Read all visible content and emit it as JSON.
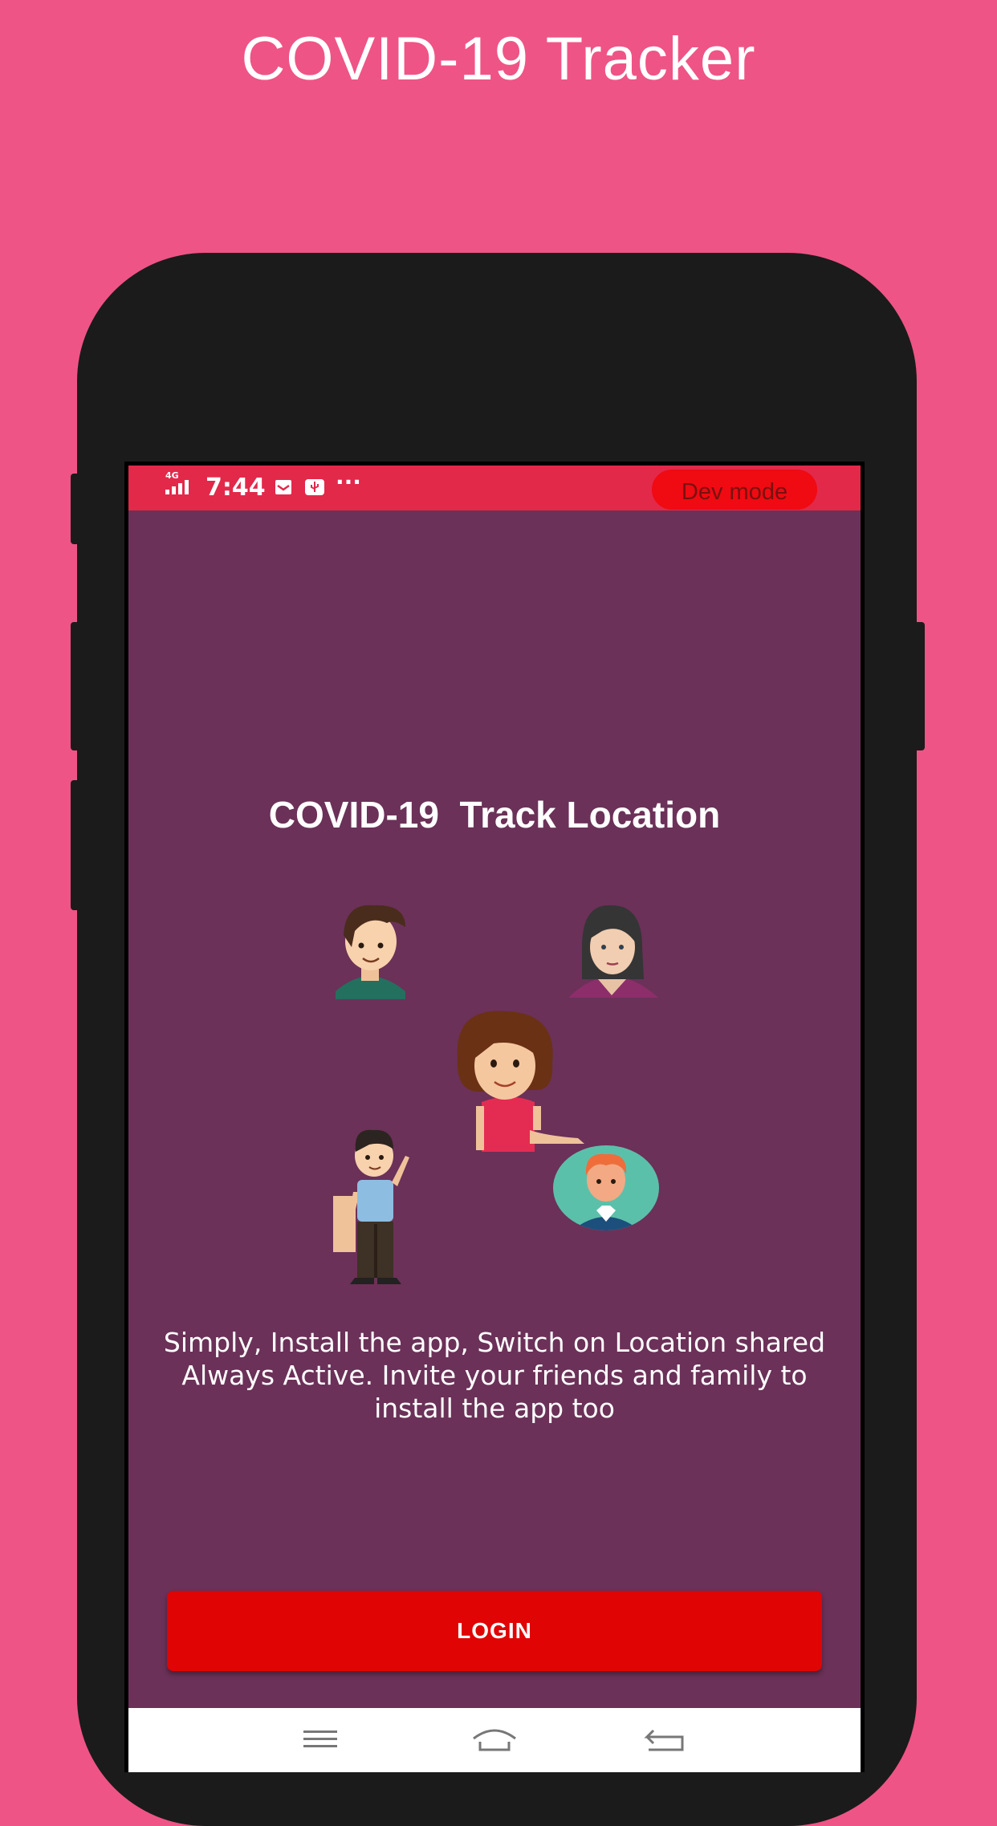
{
  "promo": {
    "headline": "COVID-19 Tracker"
  },
  "status_bar": {
    "network": "4G",
    "time": "7:44",
    "icons": [
      "signal-icon",
      "mail-icon",
      "usb-icon",
      "more-dots-icon"
    ],
    "more": "···",
    "dev_badge": "Dev mode"
  },
  "app": {
    "title": "COVID-19  Track Location",
    "description": "Simply, Install the app, Switch on Location shared Always Active. Invite your friends and family to install the app too",
    "login_label": "LOGIN",
    "colors": {
      "background": "#6b3158",
      "status_bar": "#e2294a",
      "login": "#e00404",
      "promo_bg": "#ef5486"
    }
  },
  "nav_bar": {
    "icons": [
      "menu-icon",
      "home-icon",
      "back-icon"
    ]
  }
}
